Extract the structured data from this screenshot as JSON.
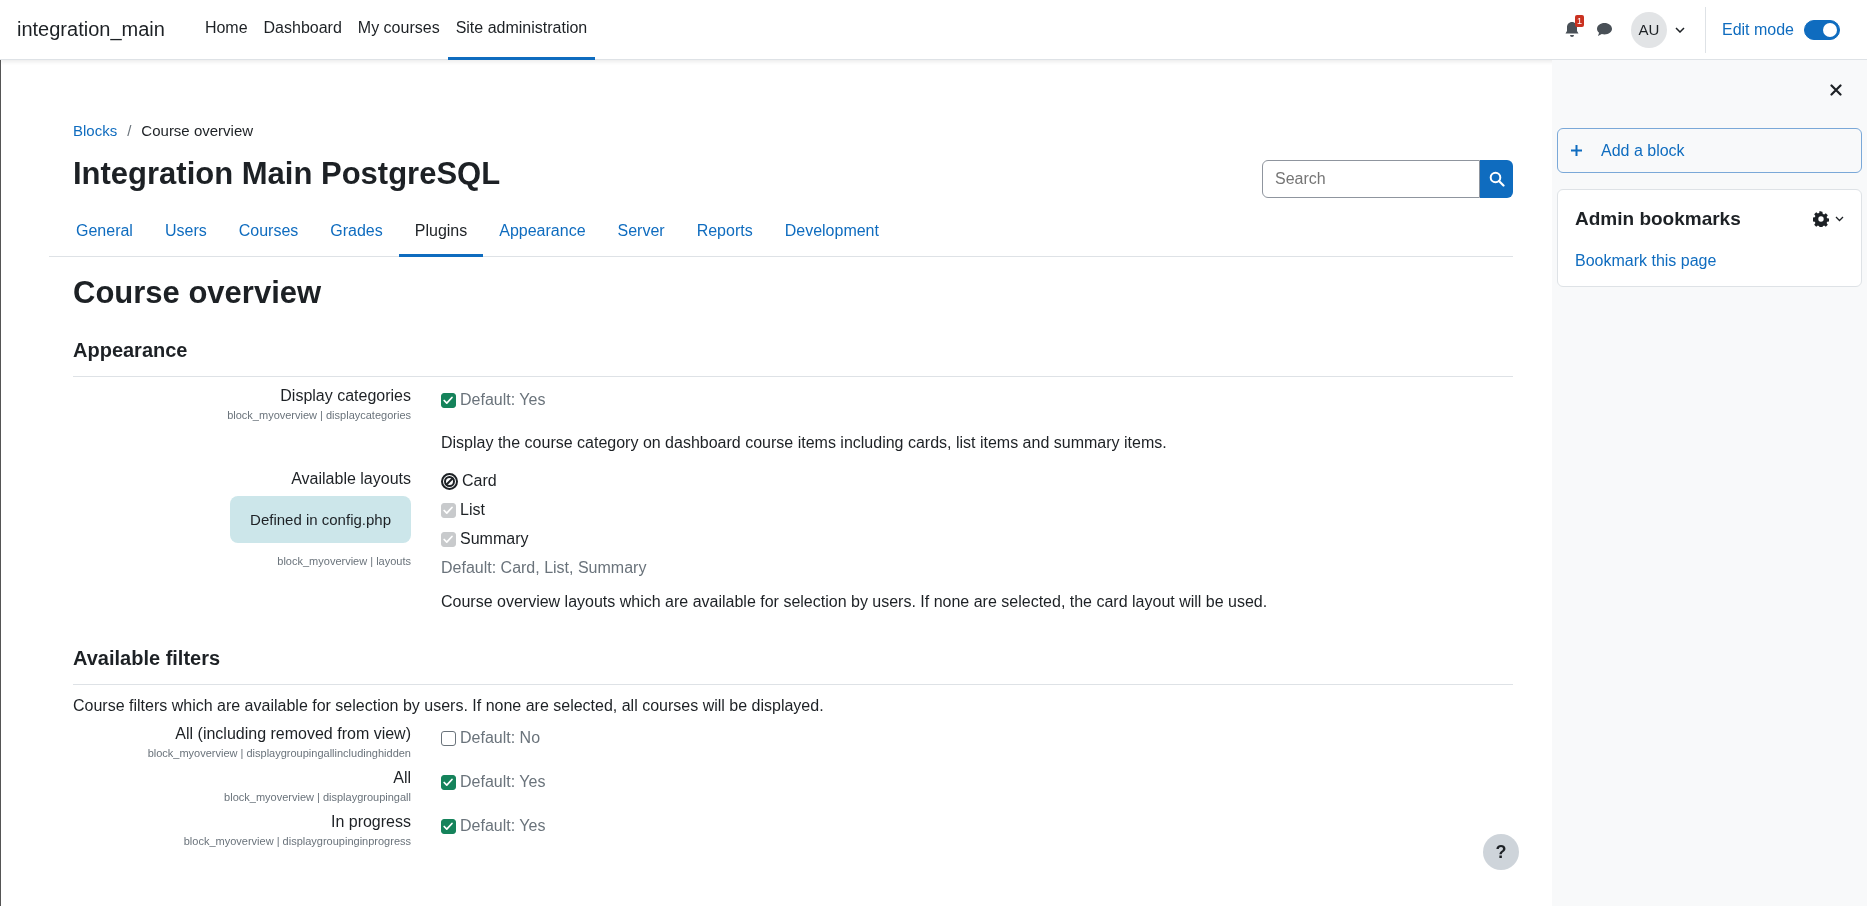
{
  "navbar": {
    "brand": "integration_main",
    "links": [
      {
        "label": "Home",
        "selected": false
      },
      {
        "label": "Dashboard",
        "selected": false
      },
      {
        "label": "My courses",
        "selected": false
      },
      {
        "label": "Site administration",
        "selected": true
      }
    ],
    "notification_count": "1",
    "avatar": "AU",
    "edit_mode": {
      "label": "Edit mode",
      "on": true
    }
  },
  "breadcrumb_separator": "/",
  "breadcrumb": [
    {
      "label": "Blocks",
      "kind": "link"
    },
    {
      "label": "Course overview",
      "kind": "current"
    }
  ],
  "page_title": "Integration Main PostgreSQL",
  "search": {
    "placeholder": "Search"
  },
  "tabs": [
    {
      "label": "General",
      "selected": false
    },
    {
      "label": "Users",
      "selected": false
    },
    {
      "label": "Courses",
      "selected": false
    },
    {
      "label": "Grades",
      "selected": false
    },
    {
      "label": "Plugins",
      "selected": true
    },
    {
      "label": "Appearance",
      "selected": false
    },
    {
      "label": "Server",
      "selected": false
    },
    {
      "label": "Reports",
      "selected": false
    },
    {
      "label": "Development",
      "selected": false
    }
  ],
  "heading": "Course overview",
  "sections": [
    {
      "title": "Appearance",
      "settings": [
        {
          "kind": "checkbox",
          "label": "Display categories",
          "key": "block_myoverview | displaycategories",
          "checked": true,
          "default": "Default: Yes",
          "description": "Display the course category on dashboard course items including cards, list items and summary items."
        },
        {
          "kind": "multicheck",
          "label": "Available layouts",
          "forced": "Defined in config.php",
          "key": "block_myoverview | layouts",
          "options": [
            {
              "label": "Card",
              "kind": "blocked"
            },
            {
              "label": "List",
              "kind": "disabled-checked"
            },
            {
              "label": "Summary",
              "kind": "disabled-checked"
            }
          ],
          "default": "Default: Card, List, Summary",
          "description": "Course overview layouts which are available for selection by users. If none are selected, the card layout will be used."
        }
      ]
    },
    {
      "title": "Available filters",
      "description": "Course filters which are available for selection by users. If none are selected, all courses will be displayed.",
      "settings": [
        {
          "kind": "checkbox",
          "label": "All (including removed from view)",
          "key": "block_myoverview | displaygroupingallincludinghidden",
          "checked": false,
          "default": "Default: No"
        },
        {
          "kind": "checkbox",
          "label": "All",
          "key": "block_myoverview | displaygroupingall",
          "checked": true,
          "default": "Default: Yes"
        },
        {
          "kind": "checkbox",
          "label": "In progress",
          "key": "block_myoverview | displaygroupinginprogress",
          "checked": true,
          "default": "Default: Yes"
        }
      ]
    }
  ],
  "drawer": {
    "add_block": "Add a block",
    "block": {
      "title": "Admin bookmarks",
      "link": "Bookmark this page"
    }
  },
  "help_button": "?"
}
